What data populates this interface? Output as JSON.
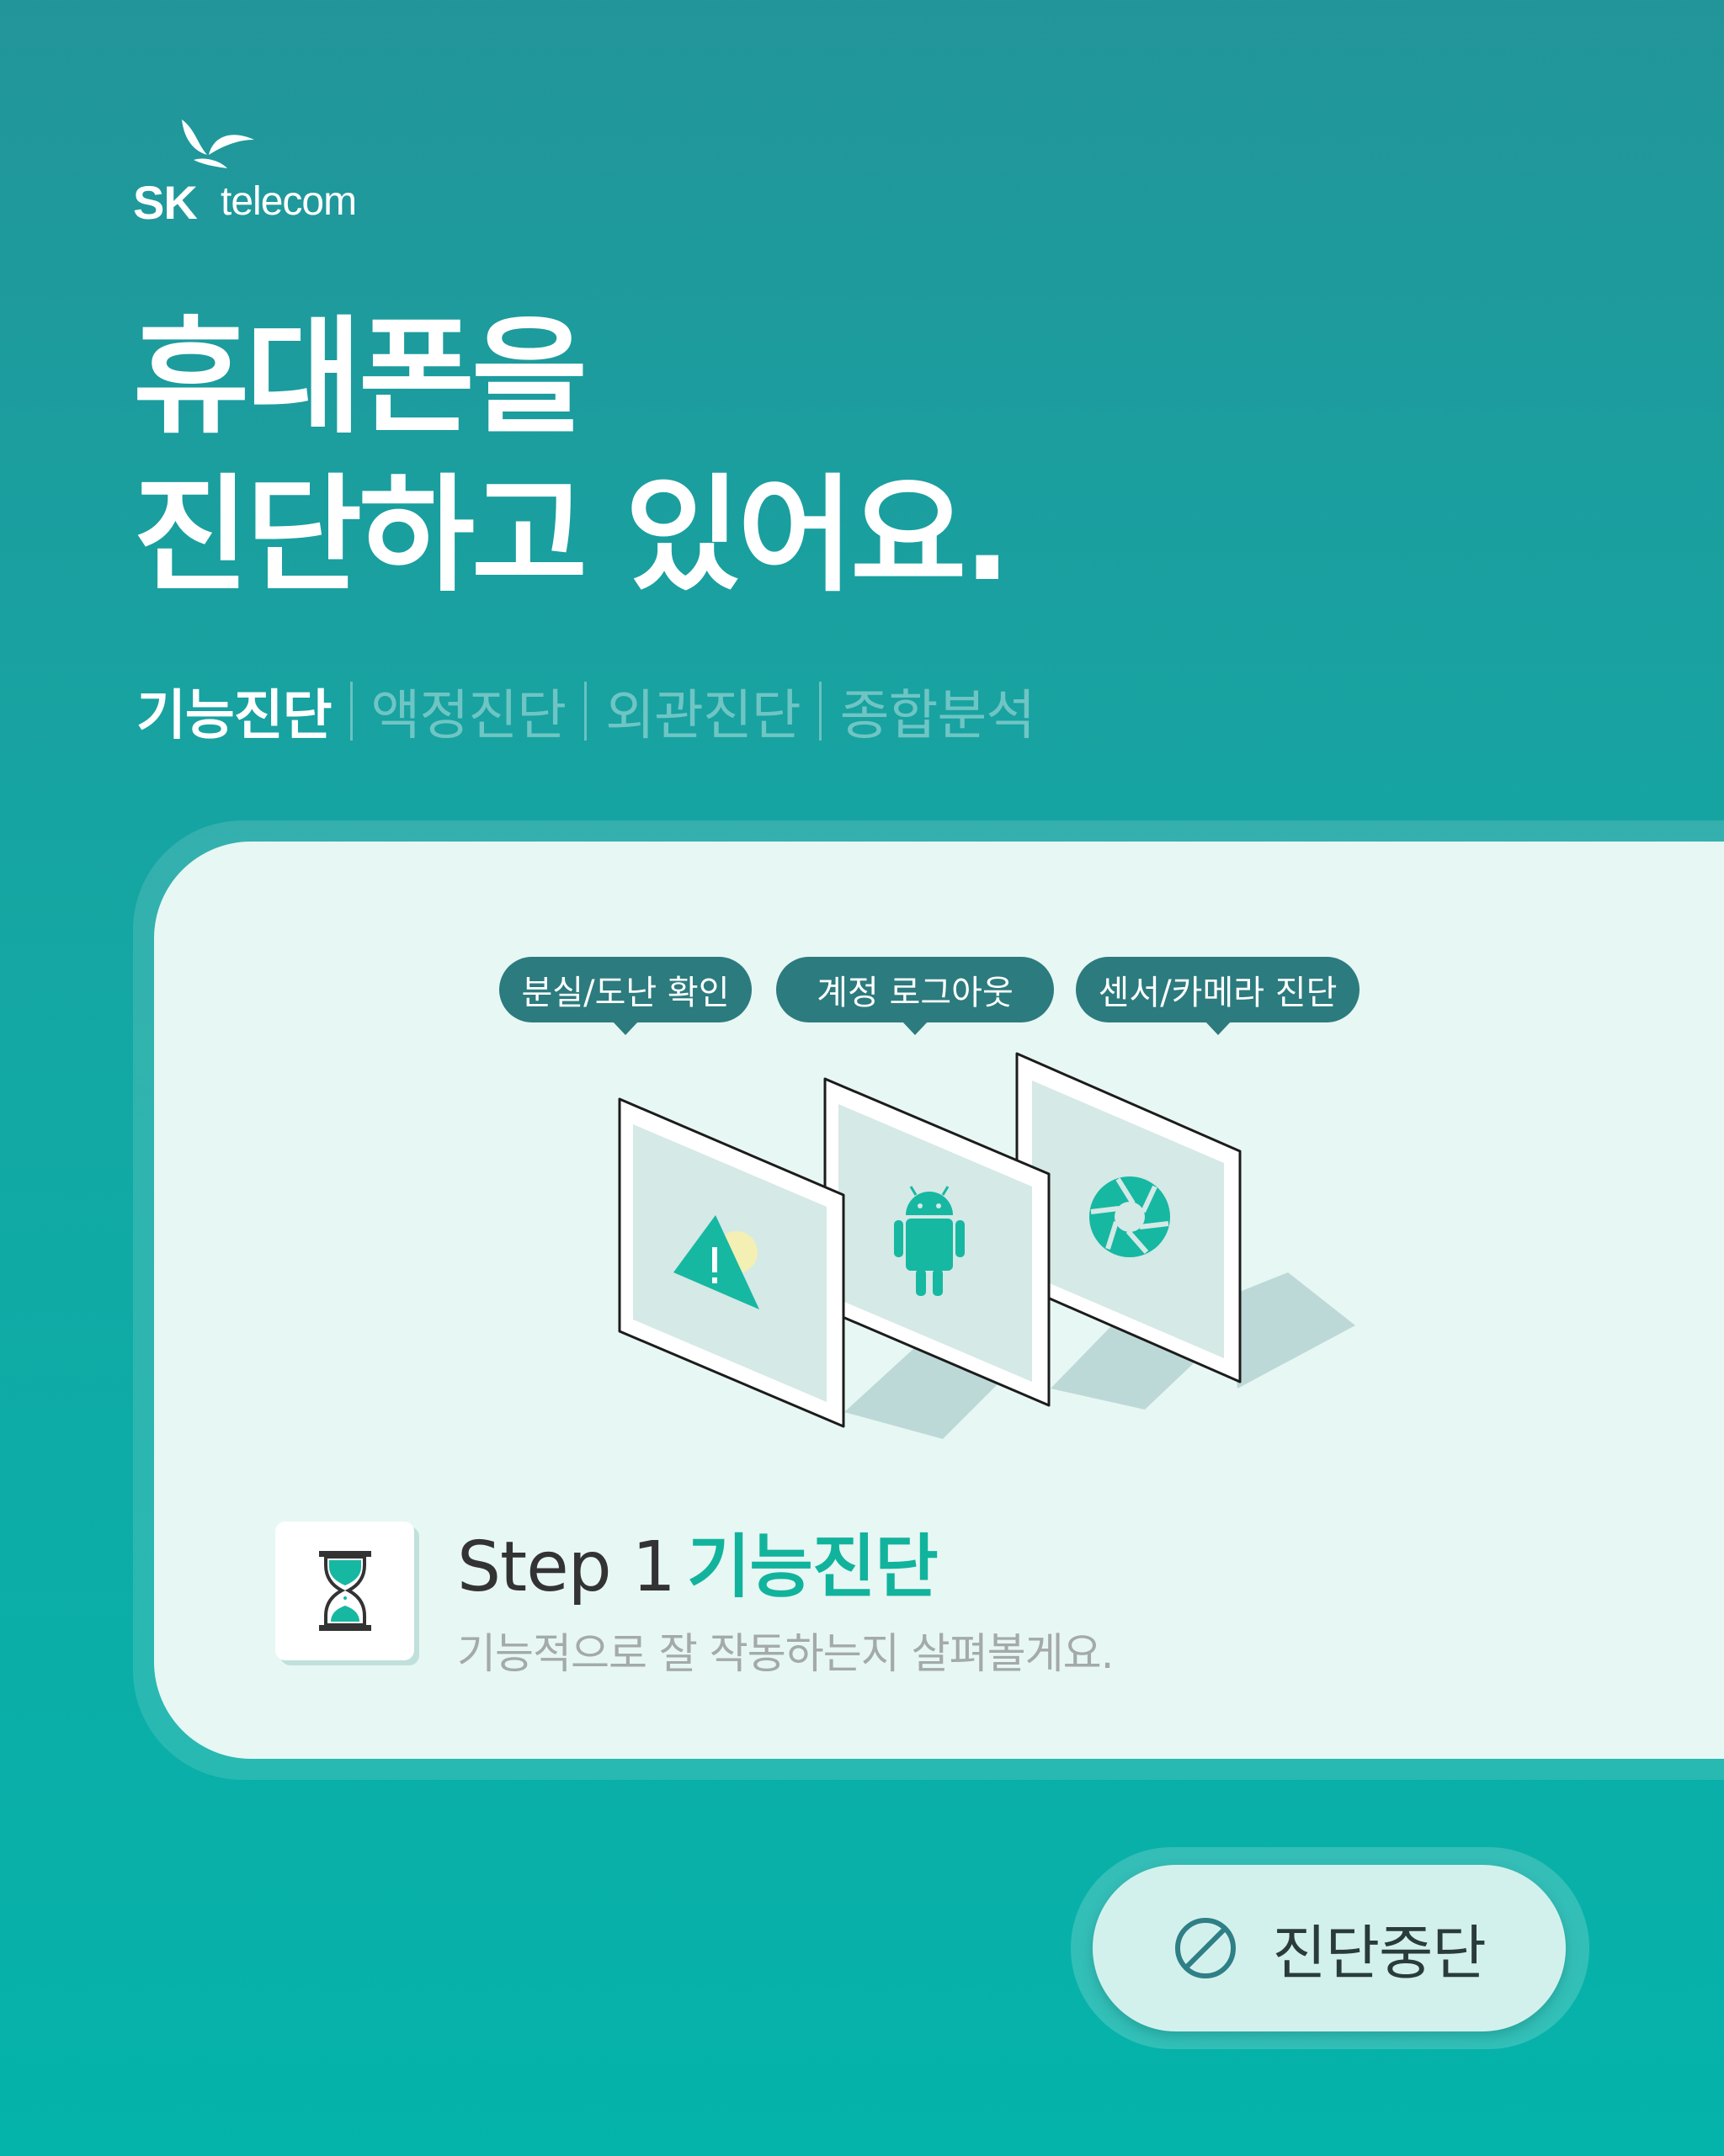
{
  "brand": {
    "logo_sk": "SK",
    "logo_telecom": "telecom"
  },
  "headline": {
    "line1": "휴대폰을",
    "line2": "진단하고 있어요."
  },
  "tabs": [
    {
      "label": "기능진단",
      "active": true
    },
    {
      "label": "액정진단",
      "active": false
    },
    {
      "label": "외관진단",
      "active": false
    },
    {
      "label": "종합분석",
      "active": false
    }
  ],
  "bubbles": [
    "분실/도난 확인",
    "계정 로그아웃",
    "센서/카메라 진단"
  ],
  "step": {
    "number": "Step 1",
    "name": "기능진단",
    "description": "기능적으로 잘 작동하는지 살펴볼게요."
  },
  "stop_button": {
    "label": "진단중단",
    "icon": "prohibited-icon"
  },
  "colors": {
    "accent": "#12b39c",
    "bubble": "#2c7b7e",
    "card": "#e7f7f4"
  }
}
